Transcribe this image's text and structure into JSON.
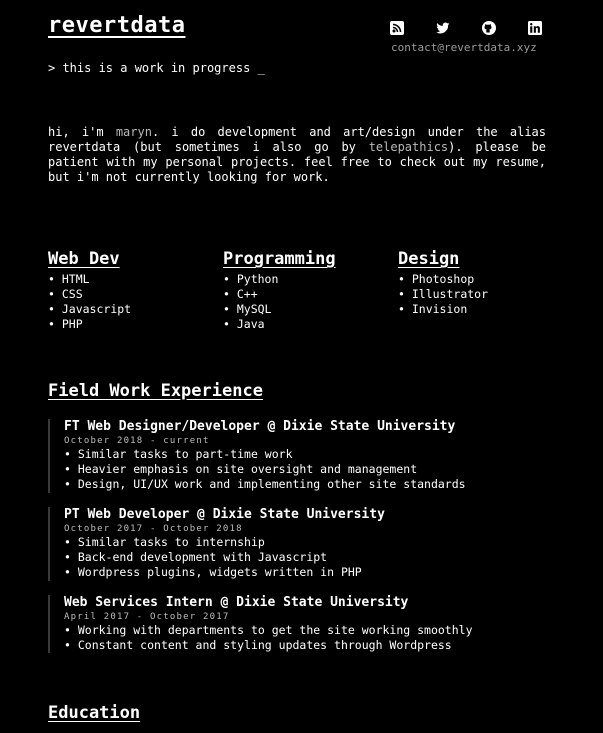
{
  "header": {
    "site_title": "revertdata",
    "contact_email": "contact@revertdata.xyz",
    "tagline": "> this is a work in progress _",
    "social_icons": [
      "rss-icon",
      "twitter-icon",
      "github-icon",
      "linkedin-icon"
    ]
  },
  "intro": {
    "part1": "hi, i'm ",
    "name": "maryn",
    "part2": ". i do development and art/design under the alias revertdata (but sometimes i also go by ",
    "alias": "telepathics",
    "part3": "). please be patient with my personal projects. feel free to check out my resume, but i'm not currently looking for work."
  },
  "skills": [
    {
      "heading": "Web Dev",
      "items": [
        "HTML",
        "CSS",
        "Javascript",
        "PHP"
      ]
    },
    {
      "heading": "Programming",
      "items": [
        "Python",
        "C++",
        "MySQL",
        "Java"
      ]
    },
    {
      "heading": "Design",
      "items": [
        "Photoshop",
        "Illustrator",
        "Invision"
      ]
    }
  ],
  "experience": {
    "heading": "Field Work Experience",
    "jobs": [
      {
        "title": "FT Web Designer/Developer @ Dixie State University",
        "dates": "October 2018 - current",
        "bullets": [
          "Similar tasks to part-time work",
          "Heavier emphasis on site oversight and management",
          "Design, UI/UX work and implementing other site standards"
        ]
      },
      {
        "title": "PT Web Developer @ Dixie State University",
        "dates": "October 2017 - October 2018",
        "bullets": [
          "Similar tasks to internship",
          "Back-end development with Javascript",
          "Wordpress plugins, widgets written in PHP"
        ]
      },
      {
        "title": "Web Services Intern @ Dixie State University",
        "dates": "April 2017 - October 2017",
        "bullets": [
          "Working with departments to get the site working smoothly",
          "Constant content and styling updates through Wordpress"
        ]
      }
    ]
  },
  "education": {
    "heading": "Education"
  },
  "colors": {
    "background": "#000000",
    "text": "#ffffff",
    "muted": "#9a9a9a",
    "highlight": "#b9b9b9"
  }
}
